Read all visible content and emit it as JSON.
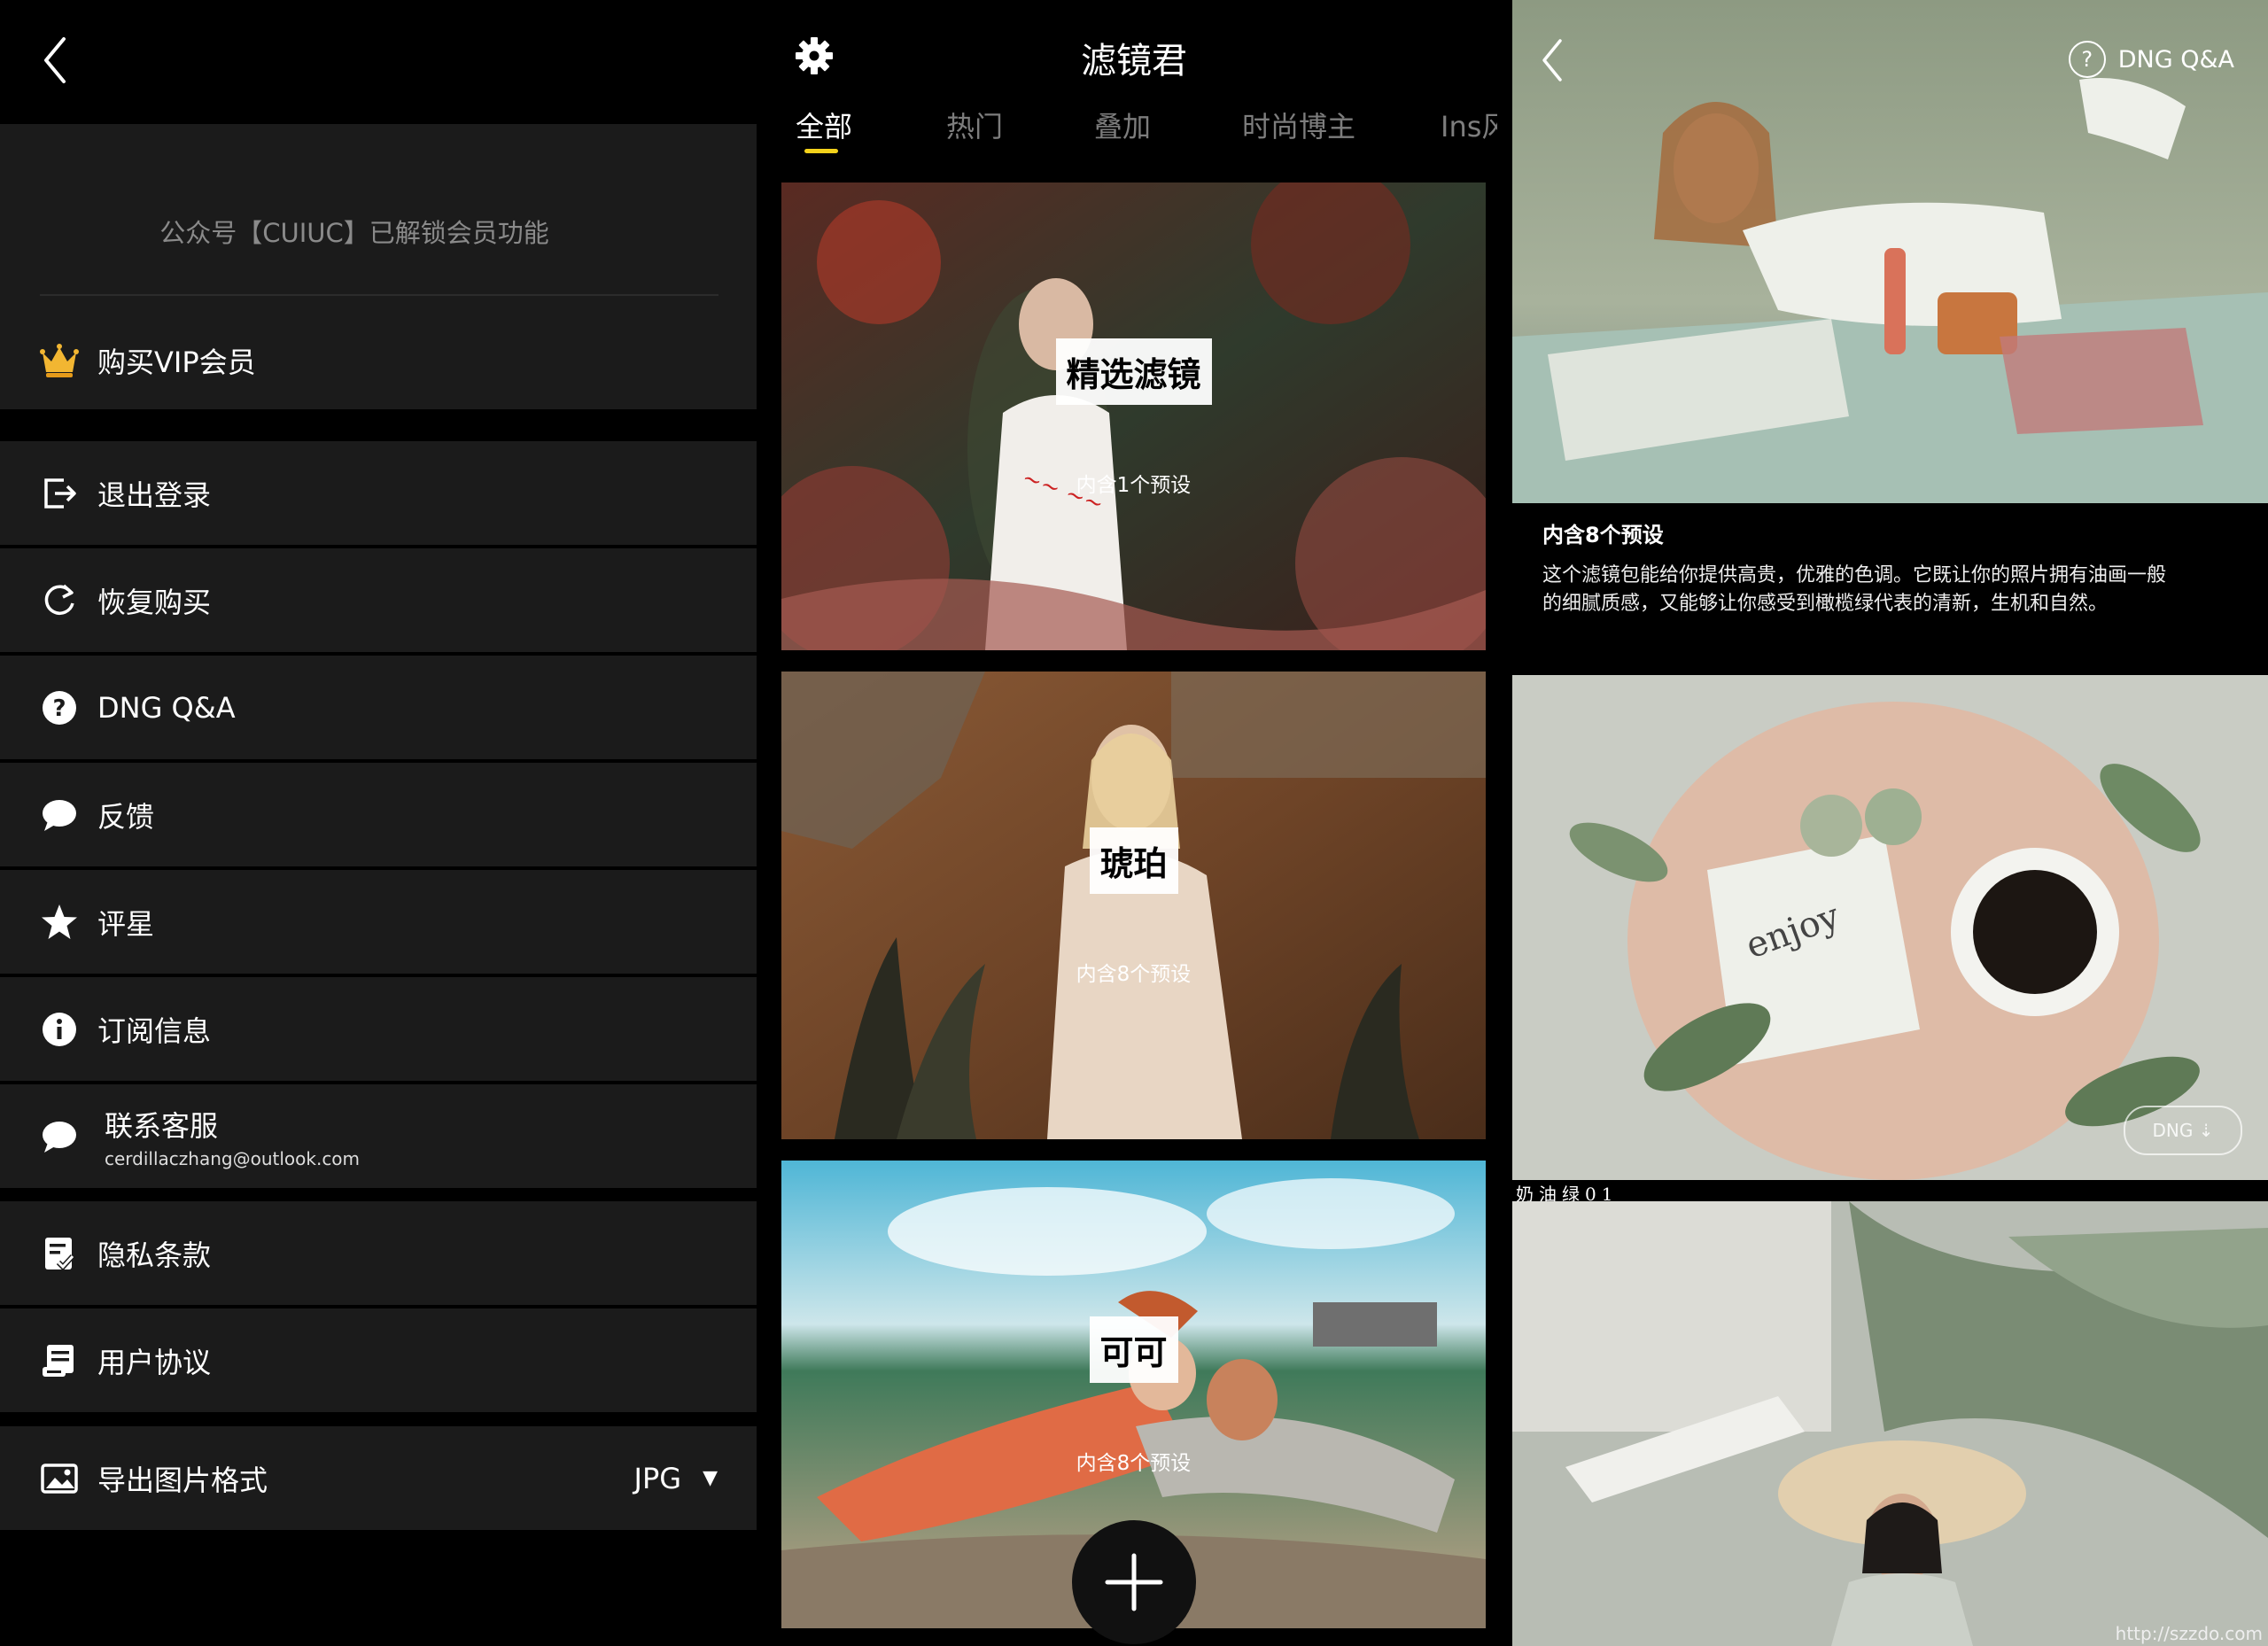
{
  "left_panel": {
    "notice": "公众号【CUIUC】已解锁会员功能",
    "vip_label": "购买VIP会员",
    "menu": [
      {
        "label": "退出登录",
        "icon": "logout-icon"
      },
      {
        "label": "恢复购买",
        "icon": "refresh-icon"
      },
      {
        "label": "DNG Q&A",
        "icon": "question-icon"
      },
      {
        "label": "反馈",
        "icon": "chat-bubble-icon"
      },
      {
        "label": "评星",
        "icon": "star-icon"
      },
      {
        "label": "订阅信息",
        "icon": "info-icon"
      }
    ],
    "contact": {
      "label": "联系客服",
      "email": "cerdillaczhang@outlook.com",
      "icon": "chat-bubble-icon"
    },
    "menu2": [
      {
        "label": "隐私条款",
        "icon": "privacy-document-icon"
      },
      {
        "label": "用户协议",
        "icon": "agreement-document-icon"
      }
    ],
    "export": {
      "label": "导出图片格式",
      "value": "JPG",
      "icon": "image-icon"
    }
  },
  "middle_panel": {
    "title": "滤镜君",
    "tabs": [
      "全部",
      "热门",
      "叠加",
      "时尚博主",
      "Ins风"
    ],
    "active_tab": "全部",
    "cards": [
      {
        "title": "精选滤镜",
        "subtitle": "内含1个预设"
      },
      {
        "title": "琥珀",
        "subtitle": "内含8个预设"
      },
      {
        "title": "可可",
        "subtitle": "内含8个预设"
      }
    ],
    "accent_color": "#f4d21b"
  },
  "right_panel": {
    "help_label": "DNG Q&A",
    "preset_count": "内含8个预设",
    "description": "这个滤镜包能给你提供高贵，优雅的色调。它既让你的照片拥有油画一般的细腻质感，又能够让你感受到橄榄绿代表的清新，生机和自然。",
    "dng_chip": "DNG ⇣",
    "image_caption": "奶油绿01",
    "watermark": "http://szzdo.com"
  }
}
